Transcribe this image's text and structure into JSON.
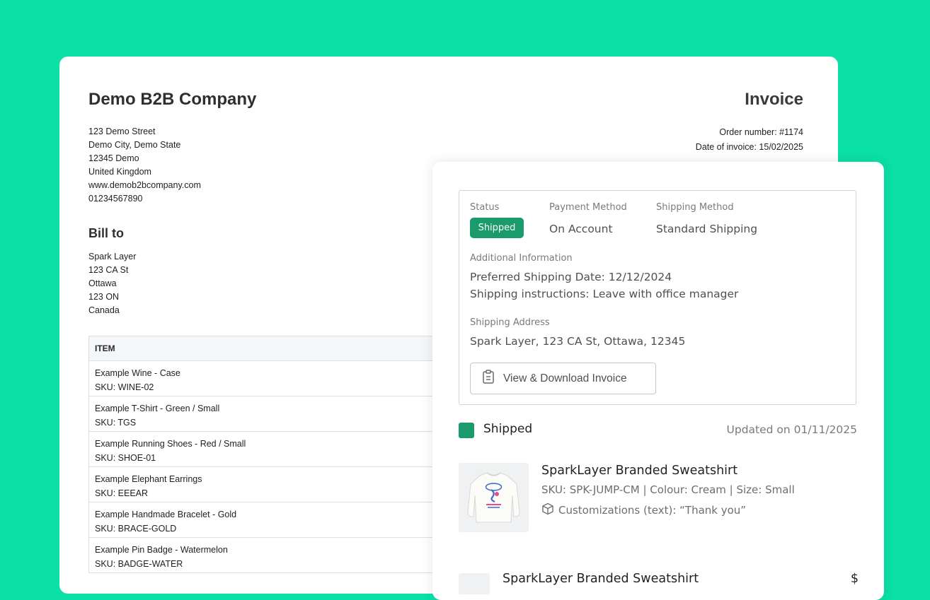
{
  "invoice": {
    "company_name": "Demo B2B Company",
    "title": "Invoice",
    "company_address": [
      "123 Demo Street",
      "Demo City, Demo State",
      "12345 Demo",
      "United Kingdom",
      "www.demob2bcompany.com",
      "01234567890"
    ],
    "order_number": "Order number: #1174",
    "date_of_invoice": "Date of invoice: 15/02/2025",
    "bill_to_title": "Bill to",
    "bill_to_address": [
      "Spark Layer",
      "123 CA St",
      "Ottawa",
      "123 ON",
      "Canada"
    ],
    "table_header": "ITEM",
    "items": [
      {
        "name": "Example Wine - Case",
        "sku": "SKU: WINE-02"
      },
      {
        "name": "Example T-Shirt - Green / Small",
        "sku": "SKU: TGS"
      },
      {
        "name": "Example Running Shoes - Red / Small",
        "sku": "SKU: SHOE-01"
      },
      {
        "name": "Example Elephant Earrings",
        "sku": "SKU: EEEAR"
      },
      {
        "name": "Example Handmade Bracelet - Gold",
        "sku": "SKU: BRACE-GOLD"
      },
      {
        "name": "Example Pin Badge - Watermelon",
        "sku": "SKU: BADGE-WATER"
      }
    ]
  },
  "order": {
    "status_label": "Status",
    "status_value": "Shipped",
    "payment_label": "Payment Method",
    "payment_value": "On Account",
    "shipping_method_label": "Shipping Method",
    "shipping_method_value": "Standard Shipping",
    "additional_label": "Additional Information",
    "additional_lines": [
      "Preferred Shipping Date: 12/12/2024",
      "Shipping instructions: Leave with office manager"
    ],
    "shipping_address_label": "Shipping Address",
    "shipping_address_value": "Spark Layer, 123 CA St, Ottawa, 12345",
    "invoice_button": "View & Download Invoice",
    "fulfillment_status": "Shipped",
    "updated": "Updated on 01/11/2025",
    "product": {
      "name": "SparkLayer Branded Sweatshirt",
      "meta": "SKU: SPK-JUMP-CM | Colour: Cream | Size: Small",
      "customization": "Customizations (text): “Thank you”"
    },
    "product2": {
      "name": "SparkLayer Branded Sweatshirt",
      "price": "$"
    }
  },
  "colors": {
    "background": "#0be0a6",
    "accent": "#1b9a6c"
  }
}
